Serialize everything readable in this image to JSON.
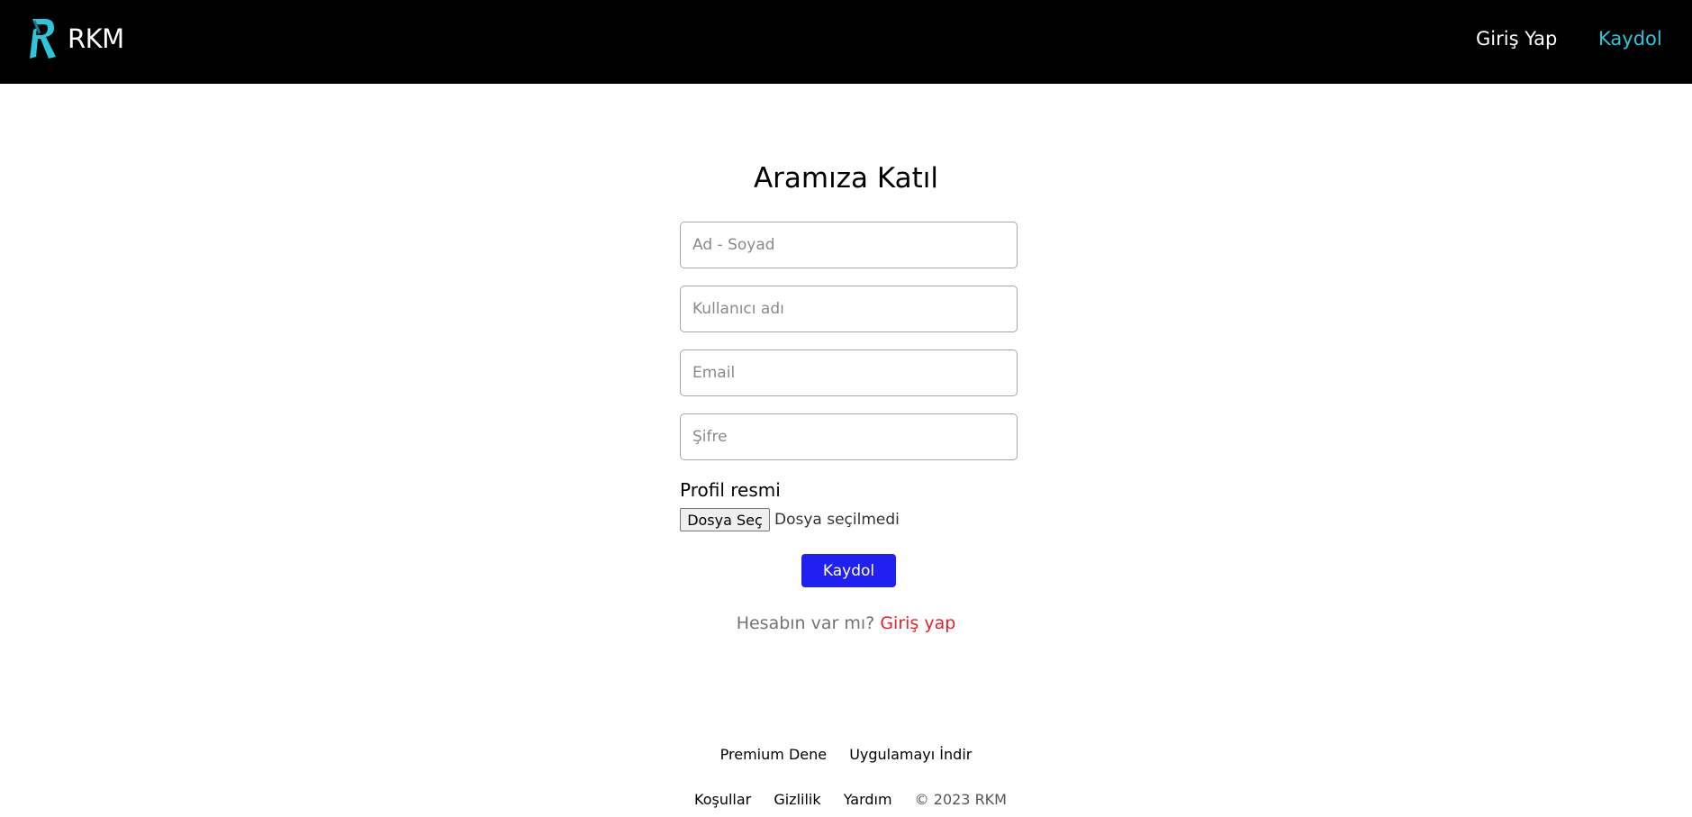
{
  "navbar": {
    "brand": "RKM",
    "links": [
      {
        "label": "Giriş Yap"
      },
      {
        "label": "Kaydol"
      }
    ]
  },
  "form": {
    "title": "Aramıza Katıl",
    "fields": {
      "name_placeholder": "Ad - Soyad",
      "username_placeholder": "Kullanıcı adı",
      "email_placeholder": "Email",
      "password_placeholder": "Şifre"
    },
    "profile_label": "Profil resmi",
    "file_button": "Dosya Seç",
    "file_status": "Dosya seçilmedi",
    "submit_label": "Kaydol",
    "account_question": "Hesabın var mı?",
    "login_link": "Giriş yap"
  },
  "footer": {
    "row1": [
      {
        "label": "Premium Dene"
      },
      {
        "label": "Uygulamayı İndir"
      }
    ],
    "row2": [
      {
        "label": "Koşullar"
      },
      {
        "label": "Gizlilik"
      },
      {
        "label": "Yardım"
      }
    ],
    "copyright": "© 2023 RKM"
  },
  "colors": {
    "navbar_bg": "#000000",
    "accent_cyan": "#2bc6dc",
    "submit_blue": "#2020f2",
    "link_red": "#e8202b"
  },
  "icons": {
    "logo": "rkm-logo-icon"
  }
}
